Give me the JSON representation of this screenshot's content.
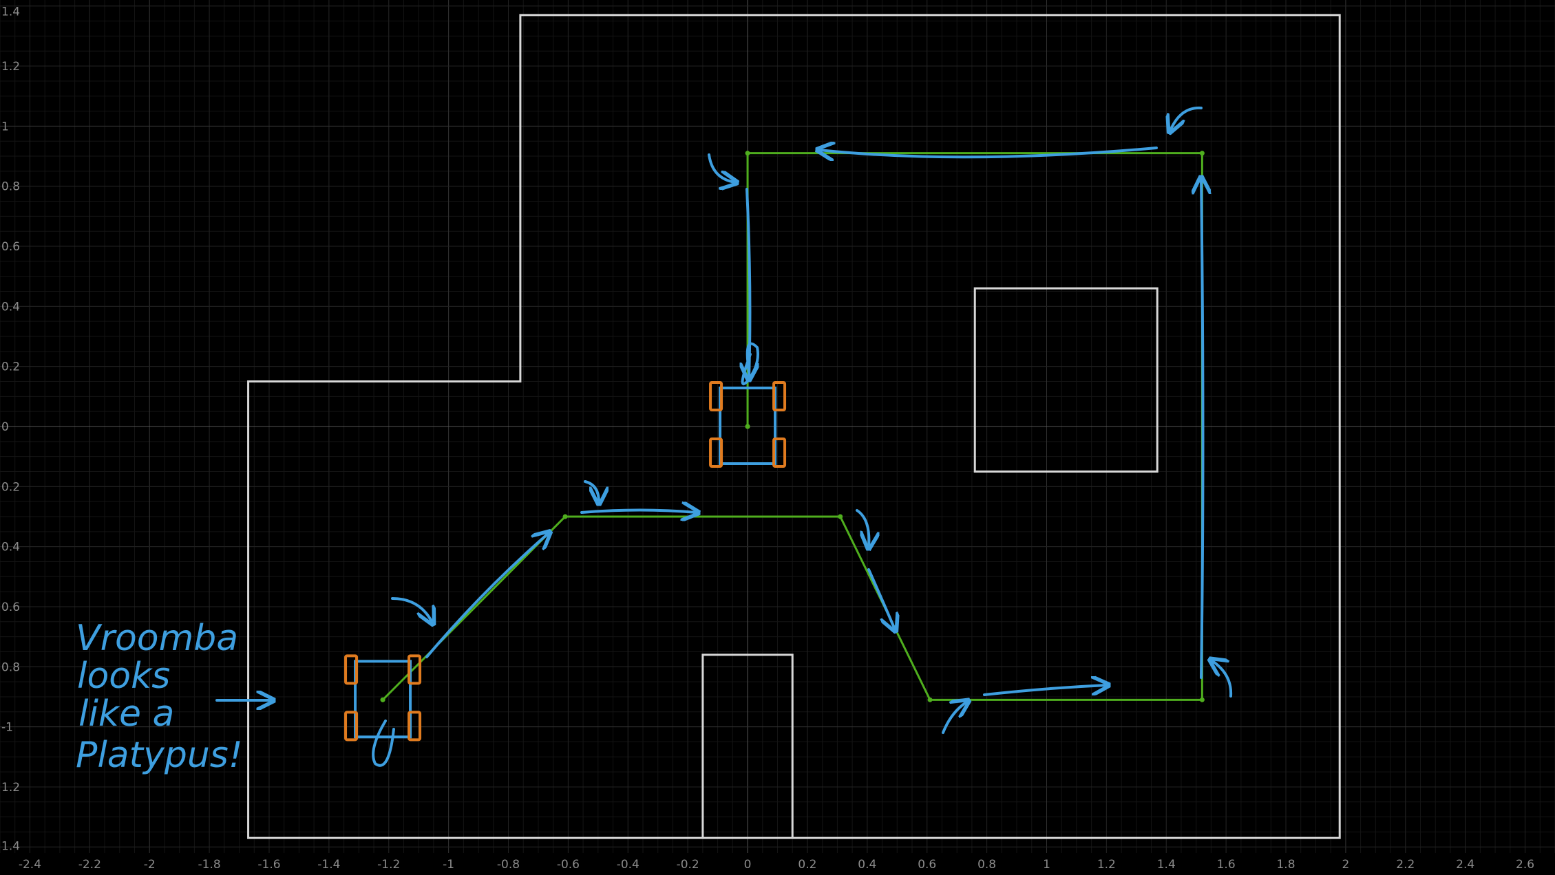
{
  "axes": {
    "x_ticks": [
      "-2.4",
      "-2.2",
      "-2",
      "-1.8",
      "-1.6",
      "-1.4",
      "-1.2",
      "-1",
      "-0.8",
      "-0.6",
      "-0.4",
      "-0.2",
      "0",
      "0.2",
      "0.4",
      "0.6",
      "0.8",
      "1",
      "1.2",
      "1.4",
      "1.6",
      "1.8",
      "2",
      "2.2",
      "2.4",
      "2.6"
    ],
    "y_ticks": [
      "1.4",
      "1.2",
      "1",
      "0.8",
      "0.6",
      "0.4",
      "0.2",
      "0",
      "0.2",
      "0.4",
      "0.6",
      "0.8",
      "-1",
      "1.2",
      "1.4"
    ],
    "x_range": [
      -2.5,
      2.7
    ],
    "y_range": [
      -1.42,
      1.42
    ],
    "grid": true
  },
  "walls": {
    "outer": [
      [
        -1.67,
        -1.37
      ],
      [
        1.98,
        -1.37
      ],
      [
        1.98,
        1.37
      ],
      [
        -0.76,
        1.37
      ],
      [
        -0.76,
        0.15
      ],
      [
        -1.67,
        0.15
      ]
    ],
    "obstacle_square": [
      [
        0.76,
        -0.15
      ],
      [
        1.37,
        0.46
      ]
    ],
    "doorway_block": [
      [
        -0.15,
        -1.37
      ],
      [
        0.15,
        -0.76
      ]
    ]
  },
  "paths": {
    "lower": [
      [
        -1.22,
        -0.91
      ],
      [
        -0.61,
        -0.3
      ],
      [
        0.31,
        -0.3
      ],
      [
        0.61,
        -0.91
      ],
      [
        1.52,
        -0.91
      ],
      [
        1.52,
        0.91
      ],
      [
        0,
        0.91
      ],
      [
        0,
        0
      ]
    ],
    "colors": {
      "path": "#4fae1e",
      "annotation": "#3e9fe0",
      "wheels": "#e07b1f",
      "walls": "#d8d8d8"
    }
  },
  "robots": [
    {
      "label": "start-robot",
      "x": -1.22,
      "y": -0.91
    },
    {
      "label": "end-robot",
      "x": 0,
      "y": 0
    }
  ],
  "annotation": {
    "lines": [
      "Vroomba",
      "looks",
      "like a",
      "Platypus!"
    ]
  }
}
